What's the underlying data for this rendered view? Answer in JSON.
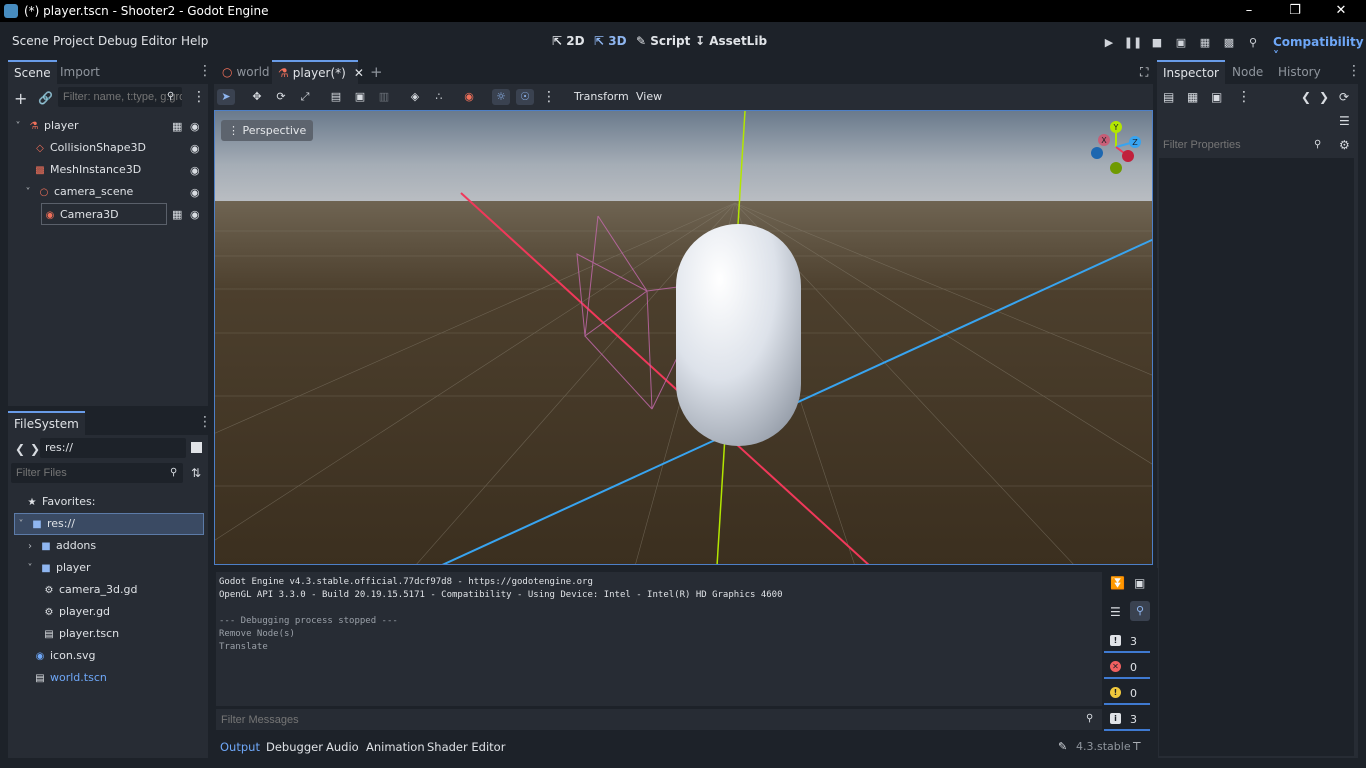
{
  "window": {
    "title": "(*) player.tscn - Shooter2 - Godot Engine"
  },
  "menu": {
    "items": [
      "Scene",
      "Project",
      "Debug",
      "Editor",
      "Help"
    ]
  },
  "modes": {
    "m2d": "2D",
    "m3d": "3D",
    "script": "Script",
    "assetlib": "AssetLib"
  },
  "renderer": "Compatibility",
  "scene_dock": {
    "tabs": [
      "Scene",
      "Import"
    ],
    "filter_placeholder": "Filter: name, t:type, g:group",
    "nodes": [
      "player",
      "CollisionShape3D",
      "MeshInstance3D",
      "camera_scene",
      "Camera3D"
    ]
  },
  "filesystem": {
    "tab": "FileSystem",
    "path": "res://",
    "filter_placeholder": "Filter Files",
    "favorites": "Favorites:",
    "items": [
      "res://",
      "addons",
      "player",
      "camera_3d.gd",
      "player.gd",
      "player.tscn",
      "icon.svg",
      "world.tscn"
    ]
  },
  "editor_tabs": [
    "world",
    "player(*)"
  ],
  "viewport_toolbar": {
    "transform": "Transform",
    "view": "View",
    "perspective": "Perspective"
  },
  "gizmo_axes": {
    "x": "X",
    "y": "Y",
    "z": "Z"
  },
  "inspector": {
    "tabs": [
      "Inspector",
      "Node",
      "History"
    ],
    "filter_placeholder": "Filter Properties"
  },
  "output": {
    "lines": [
      "Godot Engine v4.3.stable.official.77dcf97d8 - https://godotengine.org",
      "OpenGL API 3.3.0 - Build 20.19.15.5171 - Compatibility - Using Device: Intel - Intel(R) HD Graphics 4600",
      "",
      "--- Debugging process stopped ---",
      "Remove Node(s)",
      "Translate"
    ],
    "filter_placeholder": "Filter Messages",
    "counts": {
      "messages": "3",
      "errors": "0",
      "warnings": "0",
      "info": "3"
    }
  },
  "bottom_tabs": [
    "Output",
    "Debugger",
    "Audio",
    "Animation",
    "Shader Editor"
  ],
  "version": "4.3.stable",
  "colors": {
    "accent": "#699ce8",
    "x_axis": "#f0385a",
    "z_axis": "#38a4f0",
    "y_axis": "#b3e600"
  }
}
